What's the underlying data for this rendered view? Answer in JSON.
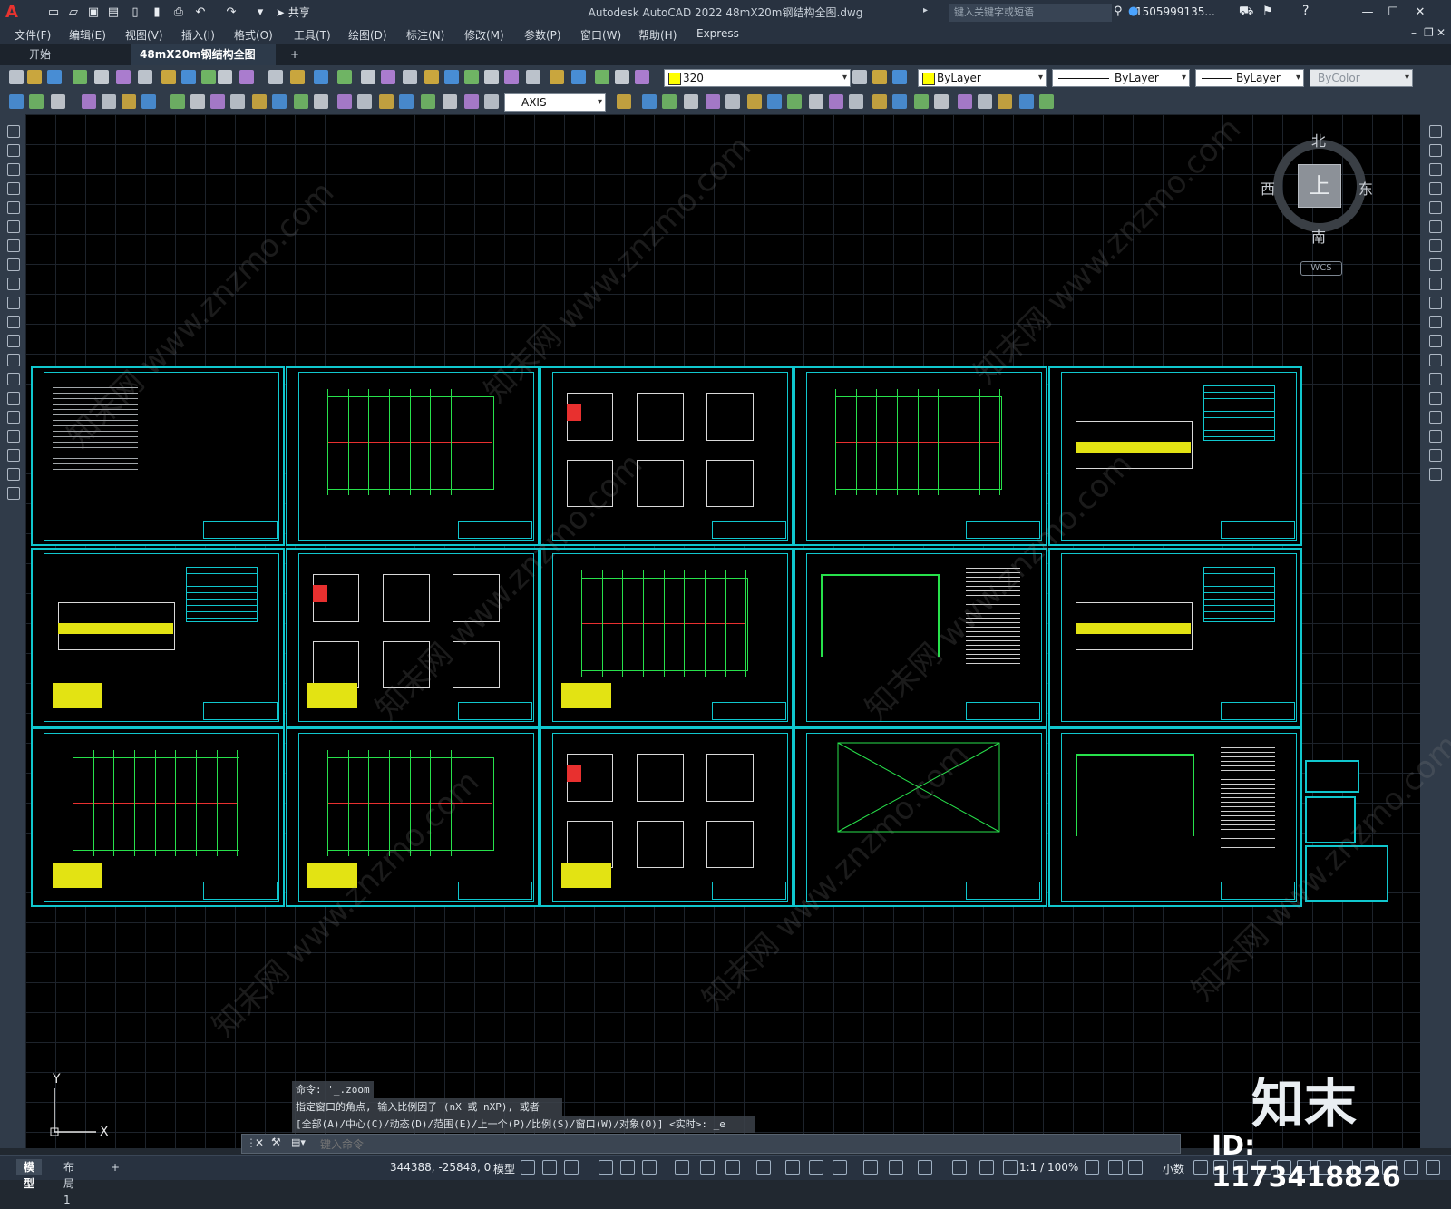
{
  "window": {
    "title": "Autodesk AutoCAD 2022    48mX20m钢结构全图.dwg",
    "app_icon": "A",
    "share_label": "共享",
    "search_placeholder": "键入关键字或短语",
    "user": "1505999135...",
    "controls": [
      "minimize-icon",
      "maximize-icon",
      "close-icon"
    ]
  },
  "menu": [
    "文件(F)",
    "编辑(E)",
    "视图(V)",
    "插入(I)",
    "格式(O)",
    "工具(T)",
    "绘图(D)",
    "标注(N)",
    "修改(M)",
    "参数(P)",
    "窗口(W)",
    "帮助(H)",
    "Express"
  ],
  "tabs": {
    "start": "开始",
    "drawing": "48mX20m钢结构全图*",
    "add": "+"
  },
  "toolbar": {
    "layer_value": "320",
    "color_value": "ByLayer",
    "linetype_value": "ByLayer",
    "lineweight_value": "ByLayer",
    "plotstyle_value": "ByColor",
    "textstyle_value": "AXIS",
    "layer_color": "#ffff00"
  },
  "viewcube": {
    "north": "北",
    "south": "南",
    "east": "东",
    "west": "西",
    "top": "上",
    "wcs": "WCS"
  },
  "ucs": {
    "x": "X",
    "y": "Y"
  },
  "command": {
    "history": [
      "命令: '_.zoom",
      "指定窗口的角点, 输入比例因子 (nX 或 nXP), 或者",
      "[全部(A)/中心(C)/动态(D)/范围(E)/上一个(P)/比例(S)/窗口(W)/对象(O)] <实时>: _e"
    ],
    "placeholder": "键入命令"
  },
  "status": {
    "tabs": [
      "模型",
      "布局1",
      "+"
    ],
    "coords": "344388, -25848, 0",
    "model_label": "模型",
    "scale": "1:1 / 100%",
    "units": "小数"
  },
  "watermark": {
    "brand": "知末",
    "id": "ID: 1173418826",
    "text": "知末网 www.znzmo.com"
  },
  "colors": {
    "sheet_border": "#10c7ce",
    "frame": "#27e14b",
    "axis_line": "#e8302f",
    "table": "#e3e313",
    "canvas": "#000000"
  }
}
